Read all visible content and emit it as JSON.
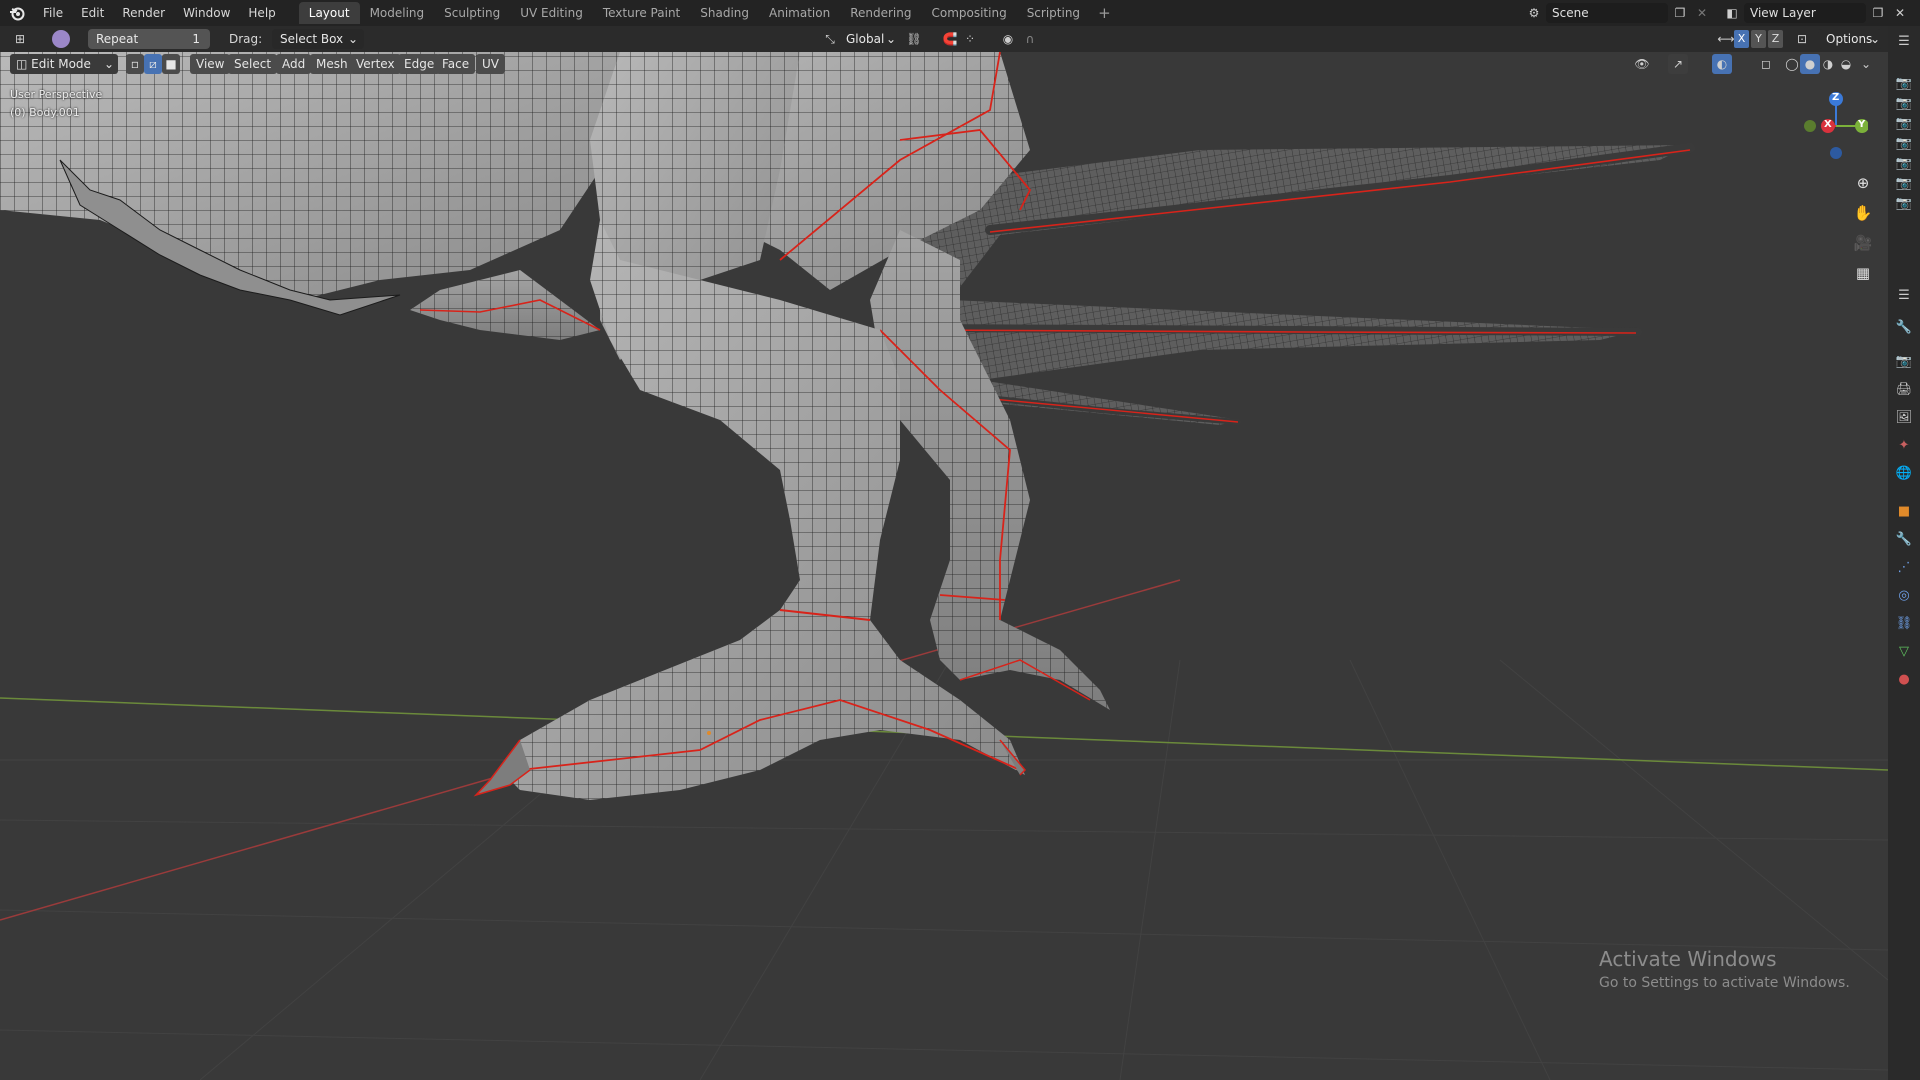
{
  "menu": [
    "File",
    "Edit",
    "Render",
    "Window",
    "Help"
  ],
  "workspaces": [
    "Layout",
    "Modeling",
    "Sculpting",
    "UV Editing",
    "Texture Paint",
    "Shading",
    "Animation",
    "Rendering",
    "Compositing",
    "Scripting"
  ],
  "active_workspace": "Layout",
  "scene": {
    "name": "Scene",
    "view_layer": "View Layer"
  },
  "tool_header": {
    "repeat_label": "Repeat",
    "repeat_value": "1",
    "drag_label": "Drag:",
    "drag_value": "Select Box",
    "orientation": "Global",
    "options_label": "Options",
    "axes": [
      "X",
      "Y",
      "Z"
    ]
  },
  "viewport_header": {
    "mode": "Edit Mode",
    "menus": [
      "View",
      "Select",
      "Add",
      "Mesh",
      "Vertex",
      "Edge",
      "Face",
      "UV"
    ]
  },
  "viewport": {
    "perspective": "User Perspective",
    "object": "(0) Body.001"
  },
  "gizmo": {
    "x": "X",
    "y": "Y",
    "z": "Z"
  },
  "watermark": {
    "title": "Activate Windows",
    "subtitle": "Go to Settings to activate Windows."
  },
  "colors": {
    "seam": "#d8231a",
    "mesh_wire": "#1a1a1a",
    "grid_x_axis": "#9a3b3b",
    "grid_y_axis": "#6b8a3b",
    "background": "#393939"
  }
}
